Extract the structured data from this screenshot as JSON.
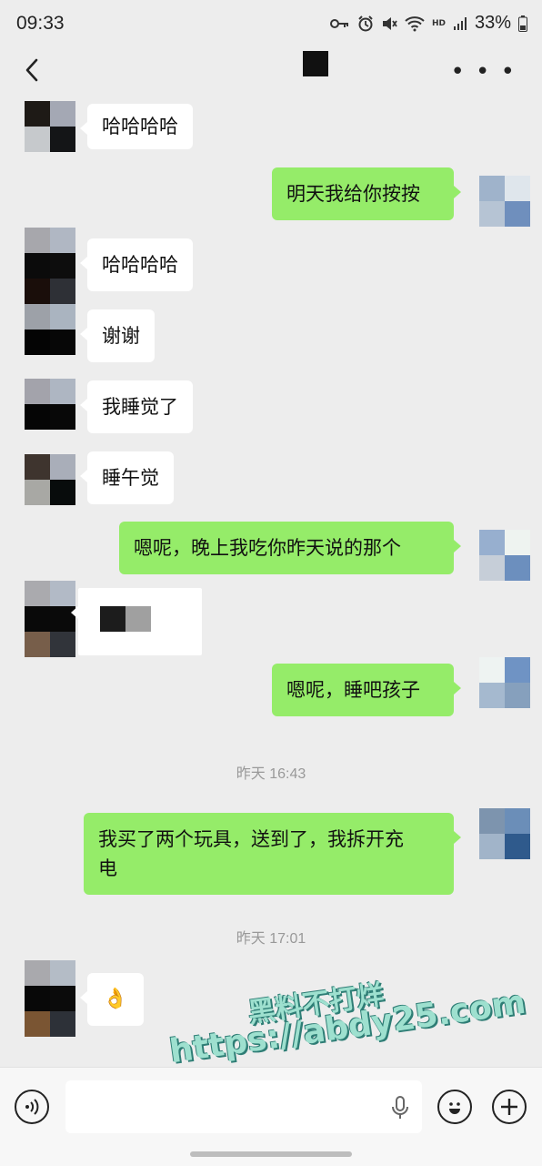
{
  "status": {
    "time": "09:33",
    "battery": "33%",
    "icons": [
      "key-icon",
      "alarm-icon",
      "mute-icon",
      "wifi-icon",
      "hd-badge",
      "signal-icon",
      "battery-icon"
    ],
    "hd_label": "HD"
  },
  "nav": {
    "back_icon": "chevron-left-icon",
    "more_icon": "more-icon"
  },
  "messages": [
    {
      "dir": "in",
      "text": "哈哈哈哈"
    },
    {
      "dir": "out",
      "text": "明天我给你按按"
    },
    {
      "dir": "in",
      "text": "哈哈哈哈"
    },
    {
      "dir": "in",
      "text": "谢谢"
    },
    {
      "dir": "in",
      "text": "我睡觉了"
    },
    {
      "dir": "in",
      "text": "睡午觉"
    },
    {
      "dir": "out",
      "text": "嗯呢，晚上我吃你昨天说的那个"
    },
    {
      "dir": "in",
      "text": ""
    },
    {
      "dir": "out",
      "text": "嗯呢，睡吧孩子"
    },
    {
      "dir": "out",
      "text": "我买了两个玩具，送到了，我拆开充电",
      "line1": "我买了两个玩具，送到了，我拆开充",
      "line2": "电"
    },
    {
      "dir": "in",
      "text": "👌"
    }
  ],
  "timestamps": [
    "昨天 16:43",
    "昨天 17:01"
  ],
  "watermark": {
    "line1": "黑料不打烊",
    "line2": "https://abdy25.com"
  },
  "colors": {
    "outgoing_bubble": "#95ec69",
    "incoming_bubble": "#ffffff",
    "background": "#ededed"
  }
}
